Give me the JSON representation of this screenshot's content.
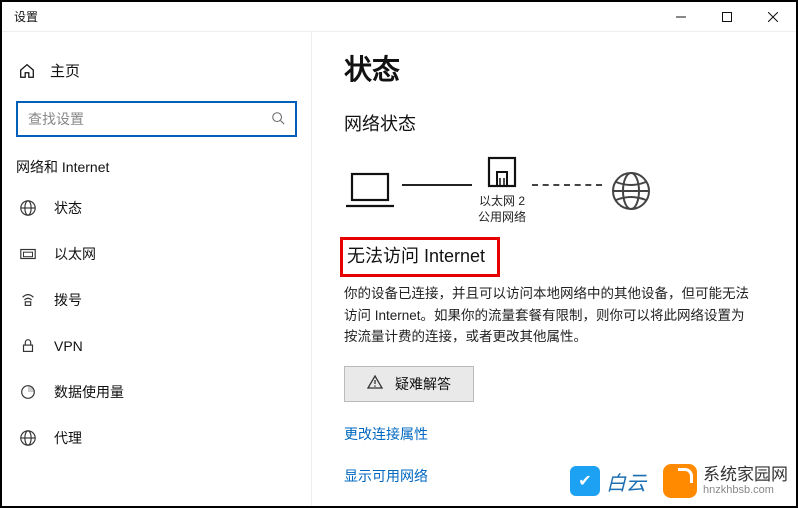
{
  "window": {
    "title": "设置"
  },
  "sidebar": {
    "home_label": "主页",
    "search_placeholder": "查找设置",
    "group_title": "网络和 Internet",
    "items": [
      {
        "icon": "status-icon",
        "label": "状态"
      },
      {
        "icon": "ethernet-icon",
        "label": "以太网"
      },
      {
        "icon": "dialup-icon",
        "label": "拨号"
      },
      {
        "icon": "vpn-icon",
        "label": "VPN"
      },
      {
        "icon": "datausage-icon",
        "label": "数据使用量"
      },
      {
        "icon": "proxy-icon",
        "label": "代理"
      }
    ]
  },
  "main": {
    "page_title": "状态",
    "section_title": "网络状态",
    "diagram": {
      "ethernet_name": "以太网 2",
      "network_type": "公用网络"
    },
    "status_heading": "无法访问 Internet",
    "description": "你的设备已连接，并且可以访问本地网络中的其他设备，但可能无法访问 Internet。如果你的流量套餐有限制，则你可以将此网络设置为按流量计费的连接，或者更改其他属性。",
    "troubleshoot_label": "疑难解答",
    "link_change_props": "更改连接属性",
    "link_show_networks": "显示可用网络"
  },
  "watermarks": {
    "w1": "白云",
    "w2_title": "系统家园网",
    "w2_url": "hnzkhbsb.com"
  }
}
